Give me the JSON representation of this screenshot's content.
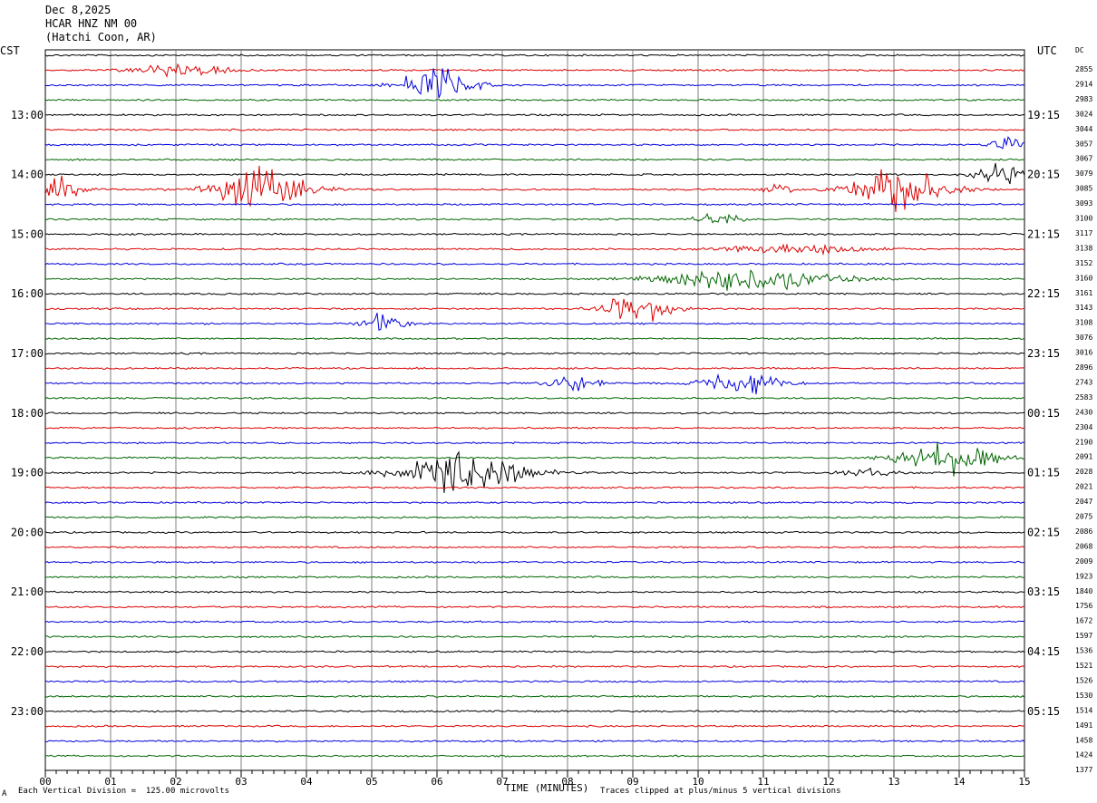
{
  "header": {
    "date": "Dec 8,2025",
    "station": "HCAR HNZ NM 00",
    "location": "(Hatchi Coon, AR)"
  },
  "chart_data": {
    "type": "line",
    "title": "",
    "xlabel": "TIME (MINUTES)",
    "ylabel": "",
    "left_axis_label": "CST",
    "right_axis_label": "UTC",
    "dc_label": "DC",
    "x_ticks": [
      "00",
      "01",
      "02",
      "03",
      "04",
      "05",
      "06",
      "07",
      "08",
      "09",
      "10",
      "11",
      "12",
      "13",
      "14",
      "15"
    ],
    "xlim": [
      0,
      15
    ],
    "left_hour_labels": [
      "13:00",
      "14:00",
      "15:00",
      "16:00",
      "17:00",
      "18:00",
      "19:00",
      "20:00",
      "21:00",
      "22:00",
      "23:00"
    ],
    "right_hour_labels": [
      "19:15",
      "20:15",
      "21:15",
      "22:15",
      "23:15",
      "00:15",
      "01:15",
      "02:15",
      "03:15",
      "04:15",
      "05:15"
    ],
    "trace_colors": [
      "#000000",
      "#dd0000",
      "#0000dd",
      "#006600"
    ],
    "grid": true,
    "dc_values": [
      2855,
      2914,
      2983,
      3024,
      3044,
      3057,
      3067,
      3079,
      3085,
      3093,
      3100,
      3117,
      3138,
      3152,
      3160,
      3161,
      3143,
      3108,
      3076,
      3016,
      2896,
      2743,
      2583,
      2430,
      2304,
      2190,
      2091,
      2028,
      2021,
      2047,
      2075,
      2086,
      2068,
      2009,
      1923,
      1840,
      1756,
      1672,
      1597,
      1536,
      1521,
      1526,
      1530,
      1514,
      1491,
      1458,
      1424,
      1377
    ],
    "events": [
      {
        "trace": 1,
        "minute": 2.1,
        "amp": 0.3,
        "width": 0.7
      },
      {
        "trace": 2,
        "minute": 6.0,
        "amp": 1.0,
        "width": 0.5
      },
      {
        "trace": 6,
        "minute": 14.8,
        "amp": 0.3,
        "width": 0.3
      },
      {
        "trace": 8,
        "minute": 14.7,
        "amp": 0.6,
        "width": 0.4
      },
      {
        "trace": 9,
        "minute": 0.1,
        "amp": 0.7,
        "width": 0.4
      },
      {
        "trace": 9,
        "minute": 3.3,
        "amp": 1.0,
        "width": 0.7
      },
      {
        "trace": 9,
        "minute": 11.2,
        "amp": 0.3,
        "width": 0.2
      },
      {
        "trace": 9,
        "minute": 13.1,
        "amp": 1.0,
        "width": 0.7
      },
      {
        "trace": 11,
        "minute": 10.3,
        "amp": 0.4,
        "width": 0.3
      },
      {
        "trace": 13,
        "minute": 11.5,
        "amp": 0.25,
        "width": 1.0
      },
      {
        "trace": 15,
        "minute": 10.8,
        "amp": 0.6,
        "width": 1.2
      },
      {
        "trace": 17,
        "minute": 9.1,
        "amp": 0.7,
        "width": 0.5
      },
      {
        "trace": 18,
        "minute": 5.2,
        "amp": 0.5,
        "width": 0.3
      },
      {
        "trace": 22,
        "minute": 8.1,
        "amp": 0.4,
        "width": 0.4
      },
      {
        "trace": 22,
        "minute": 10.7,
        "amp": 0.5,
        "width": 0.6
      },
      {
        "trace": 27,
        "minute": 13.8,
        "amp": 0.8,
        "width": 0.7
      },
      {
        "trace": 28,
        "minute": 6.4,
        "amp": 1.0,
        "width": 0.9
      },
      {
        "trace": 28,
        "minute": 12.6,
        "amp": 0.2,
        "width": 0.4
      }
    ]
  },
  "footer": {
    "left_note": "Each Vertical Division =  125.00 microvolts",
    "right_note": "Traces clipped at plus/minus 5 vertical divisions",
    "corner_mark": "A"
  }
}
